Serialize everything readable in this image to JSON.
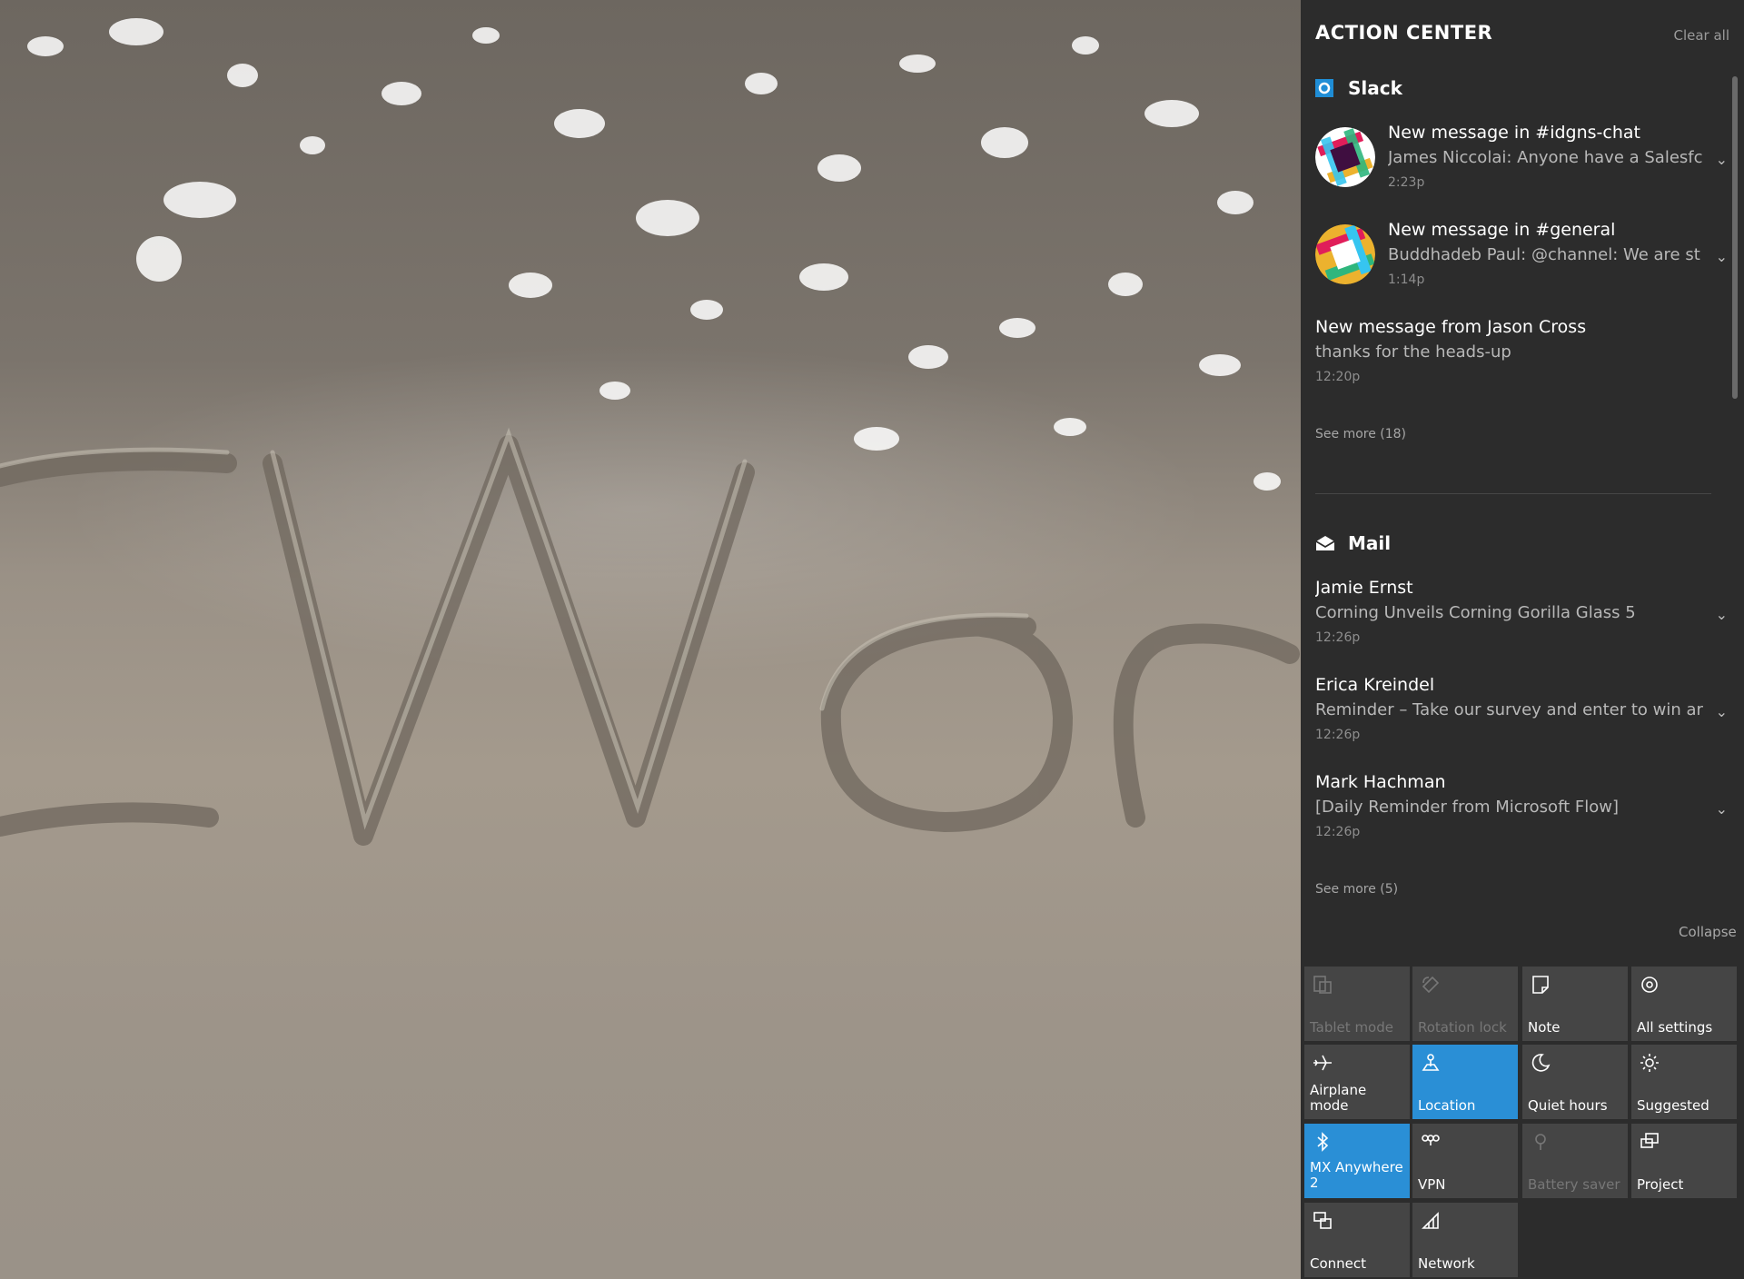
{
  "action_center": {
    "title": "ACTION CENTER",
    "clear_all": "Clear all",
    "collapse": "Collapse",
    "groups": [
      {
        "app": "Slack",
        "icon": "slack-icon",
        "notifications": [
          {
            "title": "New message in #idgns-chat",
            "body": "James Niccolai: Anyone have a Salesfc",
            "time": "2:23p"
          },
          {
            "title": "New message in #general",
            "body": "Buddhadeb Paul: @channel: We are st",
            "time": "1:14p"
          },
          {
            "title": "New message from Jason Cross",
            "body": "thanks for the heads-up",
            "time": "12:20p"
          }
        ],
        "see_more": "See more (18)"
      },
      {
        "app": "Mail",
        "icon": "mail-icon",
        "notifications": [
          {
            "title": "Jamie Ernst",
            "body": "Corning Unveils Corning Gorilla Glass 5",
            "time": "12:26p"
          },
          {
            "title": "Erica Kreindel",
            "body": "Reminder – Take our survey and enter to win ar",
            "time": "12:26p"
          },
          {
            "title": "Mark Hachman",
            "body": "[Daily Reminder from Microsoft Flow]",
            "time": "12:26p"
          }
        ],
        "see_more": "See more (5)"
      }
    ],
    "quick_actions": [
      {
        "label": "Tablet mode",
        "icon": "tablet-mode-icon",
        "state": "disabled"
      },
      {
        "label": "Rotation lock",
        "icon": "rotation-lock-icon",
        "state": "disabled"
      },
      {
        "label": "Note",
        "icon": "note-icon",
        "state": "off"
      },
      {
        "label": "All settings",
        "icon": "gear-icon",
        "state": "off"
      },
      {
        "label": "Airplane mode",
        "icon": "airplane-icon",
        "state": "off"
      },
      {
        "label": "Location",
        "icon": "location-icon",
        "state": "on"
      },
      {
        "label": "Quiet hours",
        "icon": "moon-icon",
        "state": "off"
      },
      {
        "label": "Suggested",
        "icon": "brightness-icon",
        "state": "off"
      },
      {
        "label": "MX Anywhere 2",
        "icon": "bluetooth-icon",
        "state": "on"
      },
      {
        "label": "VPN",
        "icon": "vpn-icon",
        "state": "off"
      },
      {
        "label": "Battery saver",
        "icon": "battery-saver-icon",
        "state": "disabled"
      },
      {
        "label": "Project",
        "icon": "project-icon",
        "state": "off"
      },
      {
        "label": "Connect",
        "icon": "connect-icon",
        "state": "off"
      },
      {
        "label": "Network",
        "icon": "network-icon",
        "state": "off"
      }
    ]
  },
  "colors": {
    "panel_bg": "#2c2c2c",
    "tile_bg": "#454545",
    "accent": "#2a8fd6"
  }
}
